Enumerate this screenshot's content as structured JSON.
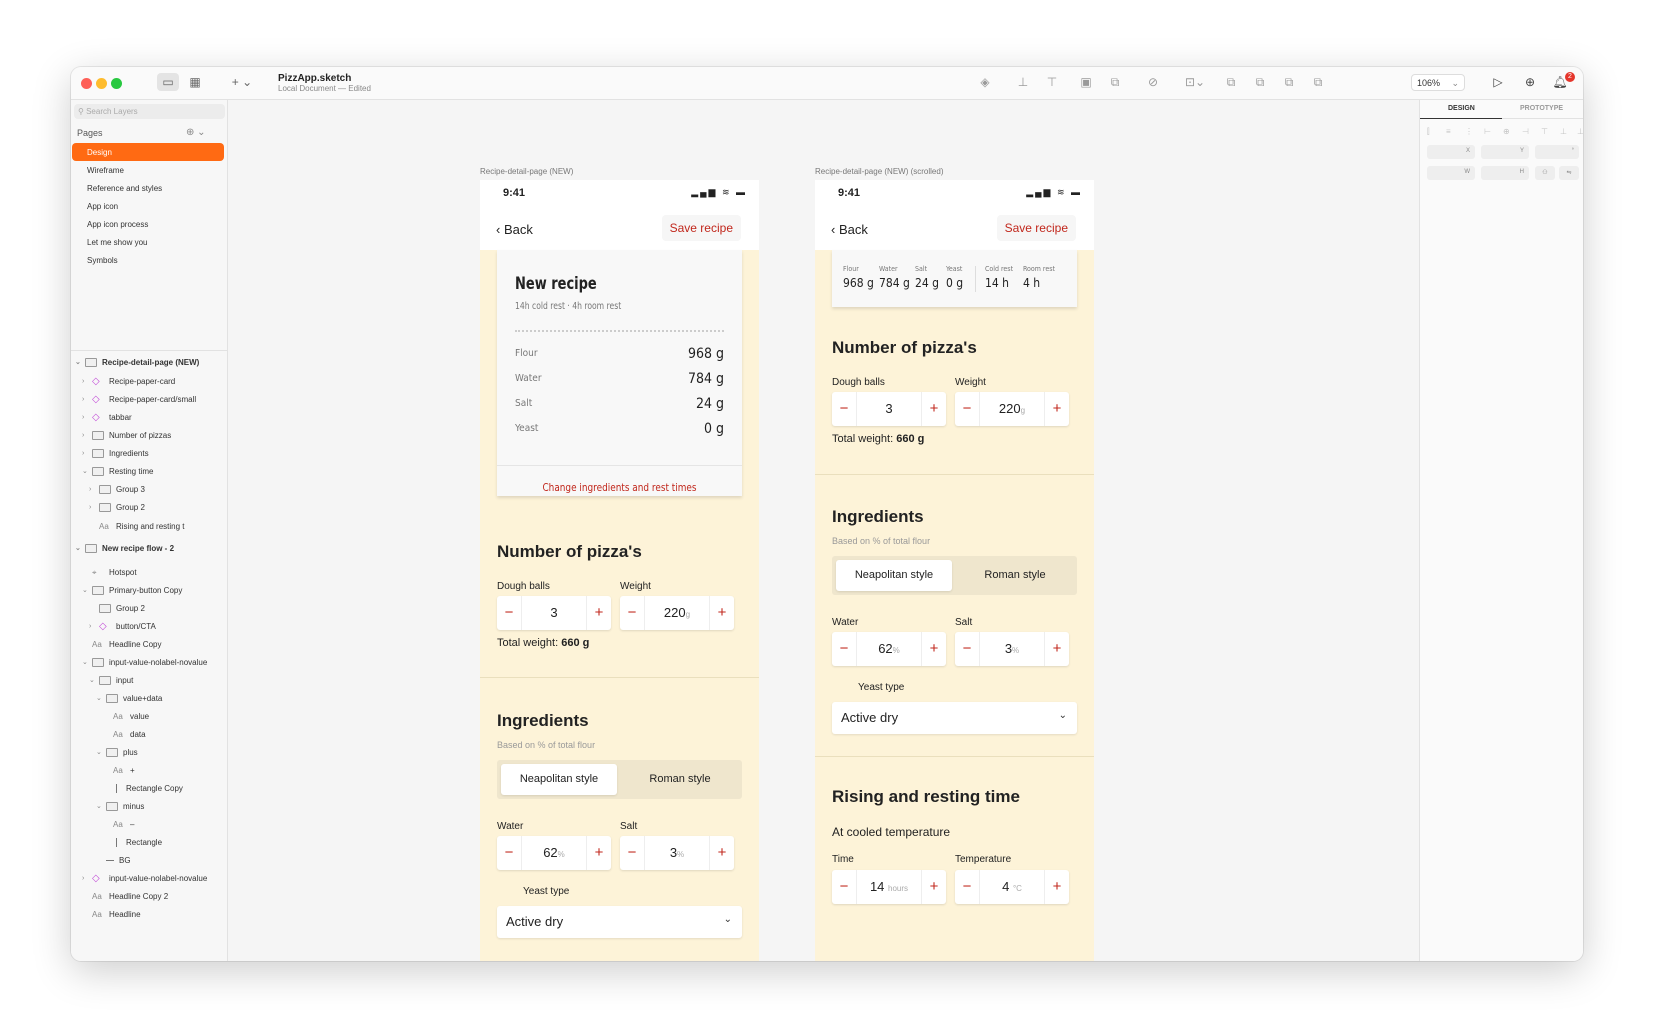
{
  "window": {
    "title": "PizzApp.sketch",
    "subtitle": "Local Document — Edited",
    "zoom": "106%",
    "notifications": "2"
  },
  "sidebar": {
    "search_placeholder": "Search Layers",
    "pages_header": "Pages",
    "pages": [
      "Design",
      "Wireframe",
      "Reference and styles",
      "App icon",
      "App icon process",
      "Let me show you",
      "Symbols"
    ],
    "layers": [
      {
        "label": "Recipe-detail-page (NEW)",
        "icon": "artboard-icon",
        "depth": 0,
        "chev": "⌄",
        "bold": true
      },
      {
        "label": "Recipe-paper-card",
        "icon": "symbol-icon",
        "depth": 1,
        "chev": "›"
      },
      {
        "label": "Recipe-paper-card/small",
        "icon": "symbol-icon",
        "depth": 1,
        "chev": "›"
      },
      {
        "label": "tabbar",
        "icon": "symbol-icon",
        "depth": 1,
        "chev": "›"
      },
      {
        "label": "Number of pizzas",
        "icon": "group-icon",
        "depth": 1,
        "chev": "›"
      },
      {
        "label": "Ingredients",
        "icon": "group-icon",
        "depth": 1,
        "chev": "›"
      },
      {
        "label": "Resting time",
        "icon": "group-icon",
        "depth": 1,
        "chev": "⌄"
      },
      {
        "label": "Group 3",
        "icon": "group-icon",
        "depth": 2,
        "chev": "›"
      },
      {
        "label": "Group 2",
        "icon": "group-icon",
        "depth": 2,
        "chev": "›"
      },
      {
        "label": "Rising and resting t",
        "icon": "text-icon",
        "depth": 2,
        "chev": ""
      },
      {
        "label": "New recipe flow - 2",
        "icon": "artboard-icon",
        "depth": 0,
        "chev": "⌄",
        "bold": true
      },
      {
        "label": "Hotspot",
        "icon": "hotspot-icon",
        "depth": 1,
        "chev": ""
      },
      {
        "label": "Primary-button Copy",
        "icon": "group-icon",
        "depth": 1,
        "chev": "⌄"
      },
      {
        "label": "Group 2",
        "icon": "group-icon",
        "depth": 2,
        "chev": ""
      },
      {
        "label": "button/CTA",
        "icon": "symbol-icon",
        "depth": 2,
        "chev": "›"
      },
      {
        "label": "Headline Copy",
        "icon": "text-icon",
        "depth": 1,
        "chev": ""
      },
      {
        "label": "input-value-nolabel-novalue",
        "icon": "group-icon",
        "depth": 1,
        "chev": "⌄"
      },
      {
        "label": "input",
        "icon": "group-icon",
        "depth": 2,
        "chev": "⌄"
      },
      {
        "label": "value+data",
        "icon": "group-icon",
        "depth": 3,
        "chev": "⌄"
      },
      {
        "label": "value",
        "icon": "text-icon",
        "depth": 4,
        "chev": ""
      },
      {
        "label": "data",
        "icon": "text-icon",
        "depth": 4,
        "chev": ""
      },
      {
        "label": "plus",
        "icon": "group-icon",
        "depth": 3,
        "chev": "⌄"
      },
      {
        "label": "+",
        "icon": "text-icon",
        "depth": 4,
        "chev": ""
      },
      {
        "label": "Rectangle Copy",
        "icon": "line-icon",
        "depth": 4,
        "chev": ""
      },
      {
        "label": "minus",
        "icon": "group-icon",
        "depth": 3,
        "chev": "⌄"
      },
      {
        "label": "–",
        "icon": "text-icon",
        "depth": 4,
        "chev": ""
      },
      {
        "label": "Rectangle",
        "icon": "line-icon",
        "depth": 4,
        "chev": ""
      },
      {
        "label": "BG",
        "icon": "shape-icon",
        "depth": 3,
        "chev": ""
      },
      {
        "label": "input-value-nolabel-novalue",
        "icon": "symbol-icon",
        "depth": 1,
        "chev": "›"
      },
      {
        "label": "Headline Copy 2",
        "icon": "text-icon",
        "depth": 1,
        "chev": ""
      },
      {
        "label": "Headline",
        "icon": "text-icon",
        "depth": 1,
        "chev": ""
      }
    ]
  },
  "artboard1": {
    "label": "Recipe-detail-page (NEW)",
    "time": "9:41",
    "back": "Back",
    "save": "Save recipe",
    "card": {
      "title": "New recipe",
      "subtitle": "14h cold rest  ·  4h room rest",
      "rows": [
        {
          "name": "Flour",
          "value": "968 g"
        },
        {
          "name": "Water",
          "value": "784 g"
        },
        {
          "name": "Salt",
          "value": "24 g"
        },
        {
          "name": "Yeast",
          "value": "0 g"
        }
      ],
      "change": "Change ingredients and rest times"
    },
    "pizzas": {
      "heading": "Number of pizza's",
      "dough_label": "Dough balls",
      "dough_value": "3",
      "weight_label": "Weight",
      "weight_value": "220",
      "weight_unit": "g",
      "total_label": "Total weight:",
      "total_value": "660 g"
    },
    "ingredients": {
      "heading": "Ingredients",
      "note": "Based on % of total flour",
      "seg_on": "Neapolitan style",
      "seg_off": "Roman style",
      "water_label": "Water",
      "water_value": "62",
      "salt_label": "Salt",
      "salt_value": "3",
      "unit": "%",
      "yeast_label": "Yeast type",
      "yeast_value": "Active dry"
    }
  },
  "artboard2": {
    "label": "Recipe-detail-page (NEW) (scrolled)",
    "time": "9:41",
    "back": "Back",
    "save": "Save recipe",
    "mini": [
      {
        "name": "Flour",
        "value": "968 g"
      },
      {
        "name": "Water",
        "value": "784 g"
      },
      {
        "name": "Salt",
        "value": "24 g"
      },
      {
        "name": "Yeast",
        "value": "0 g"
      },
      {
        "name": "Cold rest",
        "value": "14 h"
      },
      {
        "name": "Room rest",
        "value": "4 h"
      }
    ],
    "pizzas": {
      "heading": "Number of pizza's",
      "dough_label": "Dough balls",
      "dough_value": "3",
      "weight_label": "Weight",
      "weight_value": "220",
      "weight_unit": "g",
      "total_label": "Total weight:",
      "total_value": "660 g"
    },
    "ingredients": {
      "heading": "Ingredients",
      "note": "Based on % of total flour",
      "seg_on": "Neapolitan style",
      "seg_off": "Roman style",
      "water_label": "Water",
      "water_value": "62",
      "salt_label": "Salt",
      "salt_value": "3",
      "unit": "%",
      "yeast_label": "Yeast type",
      "yeast_value": "Active dry"
    },
    "rising": {
      "heading": "Rising and resting time",
      "subheading": "At cooled temperature",
      "time_label": "Time",
      "time_value": "14",
      "time_unit": "hours",
      "temp_label": "Temperature",
      "temp_value": "4",
      "temp_unit": "°C"
    }
  },
  "inspector": {
    "tab_design": "DESIGN",
    "tab_prototype": "PROTOTYPE",
    "x": "X",
    "y": "Y",
    "w": "W",
    "h": "H",
    "deg": "°"
  },
  "colors": {
    "accent": "#ff6a13",
    "brand_red": "#c1271c",
    "cream": "#fdf3d8"
  }
}
